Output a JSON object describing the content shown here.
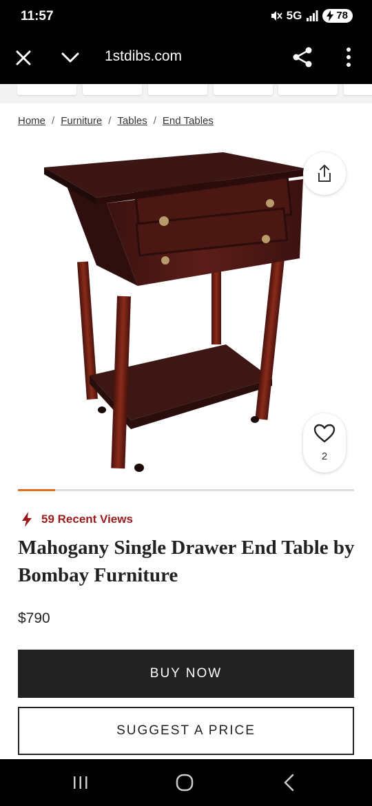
{
  "status_bar": {
    "time": "11:57",
    "network": "5G",
    "battery": "78"
  },
  "browser": {
    "url": "1stdibs.com"
  },
  "breadcrumb": {
    "items": [
      "Home",
      "Furniture",
      "Tables",
      "End Tables"
    ],
    "separator": "/"
  },
  "carousel": {
    "favorite_count": "2",
    "progress_fraction": 0.11
  },
  "product": {
    "recent_views": "59 Recent Views",
    "title": "Mahogany Single Drawer End Table by Bombay Furniture",
    "price": "$790"
  },
  "actions": {
    "buy_now": "BUY NOW",
    "suggest_price": "SUGGEST A PRICE"
  },
  "colors": {
    "accent": "#e06b1f",
    "recent_views": "#9b1b1b",
    "button_dark": "#222222"
  }
}
